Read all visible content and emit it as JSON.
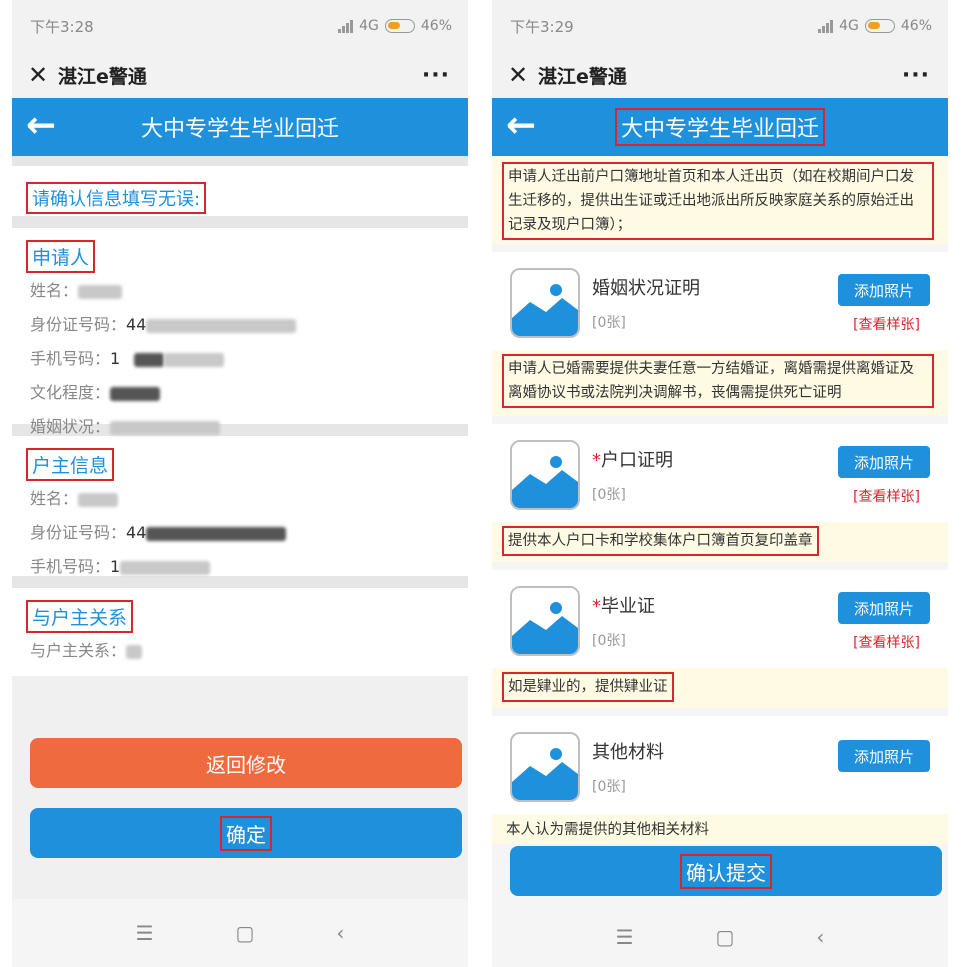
{
  "left": {
    "status": {
      "time": "下午3:28",
      "network": "4G",
      "battery": "46%"
    },
    "app_title": "湛江e警通",
    "more": "···",
    "page_title": "大中专学生毕业回迁",
    "confirm_prompt": "请确认信息填写无误:",
    "applicant": {
      "title": "申请人",
      "fields": [
        {
          "label": "姓名：",
          "value": ""
        },
        {
          "label": "身份证号码：",
          "value": "44"
        },
        {
          "label": "手机号码：",
          "value": "1"
        },
        {
          "label": "文化程度：",
          "value": ""
        },
        {
          "label": "婚姻状况：",
          "value": ""
        }
      ]
    },
    "householder": {
      "title": "户主信息",
      "fields": [
        {
          "label": "姓名：",
          "value": ""
        },
        {
          "label": "身份证号码：",
          "value": "44"
        },
        {
          "label": "手机号码：",
          "value": "1"
        }
      ]
    },
    "relation": {
      "title": "与户主关系",
      "fields": [
        {
          "label": "与户主关系：",
          "value": ""
        }
      ]
    },
    "buttons": {
      "back": "返回修改",
      "confirm": "确定"
    }
  },
  "right": {
    "status": {
      "time": "下午3:29",
      "network": "4G",
      "battery": "46%"
    },
    "app_title": "湛江e警通",
    "more": "···",
    "page_title": "大中专学生毕业回迁",
    "note_top": "申请人迁出前户口簿地址首页和本人迁出页（如在校期间户口发生迁移的，提供出生证或迁出地派出所反映家庭关系的原始迁出记录及现户口簿）；",
    "items": [
      {
        "name": "婚姻状况证明",
        "required": false,
        "count": "[0张]",
        "add": "添加照片",
        "sample": "[查看样张]"
      },
      {
        "name": "户口证明",
        "required": true,
        "count": "[0张]",
        "add": "添加照片",
        "sample": "[查看样张]"
      },
      {
        "name": "毕业证",
        "required": true,
        "count": "[0张]",
        "add": "添加照片",
        "sample": "[查看样张]"
      },
      {
        "name": "其他材料",
        "required": false,
        "count": "[0张]",
        "add": "添加照片",
        "sample": ""
      }
    ],
    "notes": [
      "申请人已婚需要提供夫妻任意一方结婚证，离婚需提供离婚证及离婚协议书或法院判决调解书，丧偶需提供死亡证明",
      "提供本人户口卡和学校集体户口簿首页复印盖章",
      "如是肄业的，提供肄业证",
      "本人认为需提供的其他相关材料"
    ],
    "submit": "确认提交",
    "required_mark": "*"
  },
  "nav": {
    "menu": "☰",
    "home": "▢",
    "back": "‹"
  },
  "colors": {
    "primary": "#1e90dc",
    "orange": "#ef6a3e",
    "highlight_red": "#d9252c",
    "note_bg": "#fffae3"
  }
}
